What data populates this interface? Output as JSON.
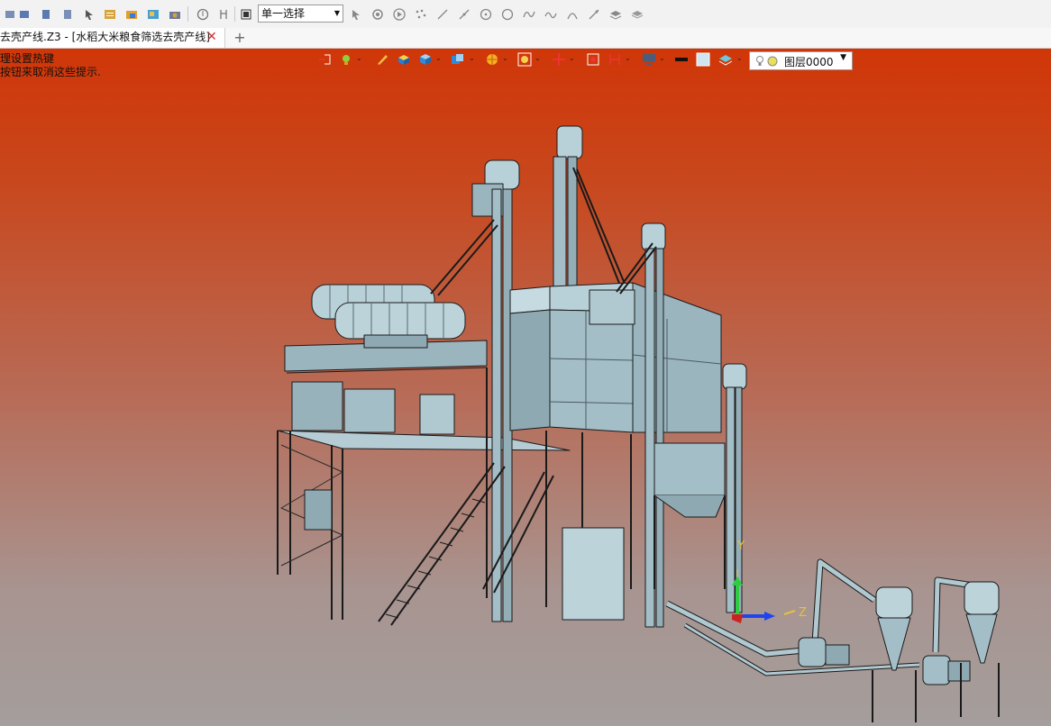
{
  "toolbar": {
    "select_mode_value": "单一选择",
    "icons": [
      "filter-icon",
      "filter-icon-2",
      "filter-icon-3",
      "filter-icon-4",
      "pointer-icon",
      "list-icon",
      "folder-icon",
      "image-icon",
      "camera-icon",
      "pick-icon",
      "snap-icon",
      "stop-icon",
      "cursor-icon",
      "target-icon",
      "play-icon",
      "points-icon",
      "line-icon",
      "segment-icon",
      "circle-point-icon",
      "circle-icon",
      "curve-icon",
      "wave-icon",
      "arc-icon",
      "tangent-icon",
      "surface-icon",
      "layers-icon"
    ]
  },
  "tab": {
    "title": "去壳产线.Z3 - [水稻大米粮食筛选去壳产线]",
    "close_glyph": "✕",
    "add_glyph": "+"
  },
  "hint": {
    "line1": "理设置热键",
    "line2": "按钮来取消这些提示."
  },
  "view_toolbar": {
    "layer_name": "图层0000"
  },
  "axes": {
    "y": "Y",
    "z": "Z"
  },
  "colors": {
    "bg_top": "#d03608",
    "bg_bottom": "#a49e9c",
    "machine_fill": "#a9c3cc",
    "machine_stroke": "#1a1a1a"
  }
}
